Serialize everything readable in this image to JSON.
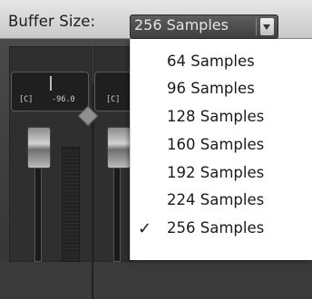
{
  "toolbar": {
    "buffer_label": "Buffer Size:",
    "buffer_value": "256 Samples"
  },
  "mixer": {
    "meter_tag_1": "[C]",
    "meter_value_1": "-96.0",
    "meter_tag_2": "[C]"
  },
  "menu": {
    "items": [
      {
        "label": "64 Samples",
        "checked": false
      },
      {
        "label": "96 Samples",
        "checked": false
      },
      {
        "label": "128 Samples",
        "checked": false
      },
      {
        "label": "160 Samples",
        "checked": false
      },
      {
        "label": "192 Samples",
        "checked": false
      },
      {
        "label": "224 Samples",
        "checked": false
      },
      {
        "label": "256 Samples",
        "checked": true,
        "mark": "✓"
      }
    ]
  }
}
